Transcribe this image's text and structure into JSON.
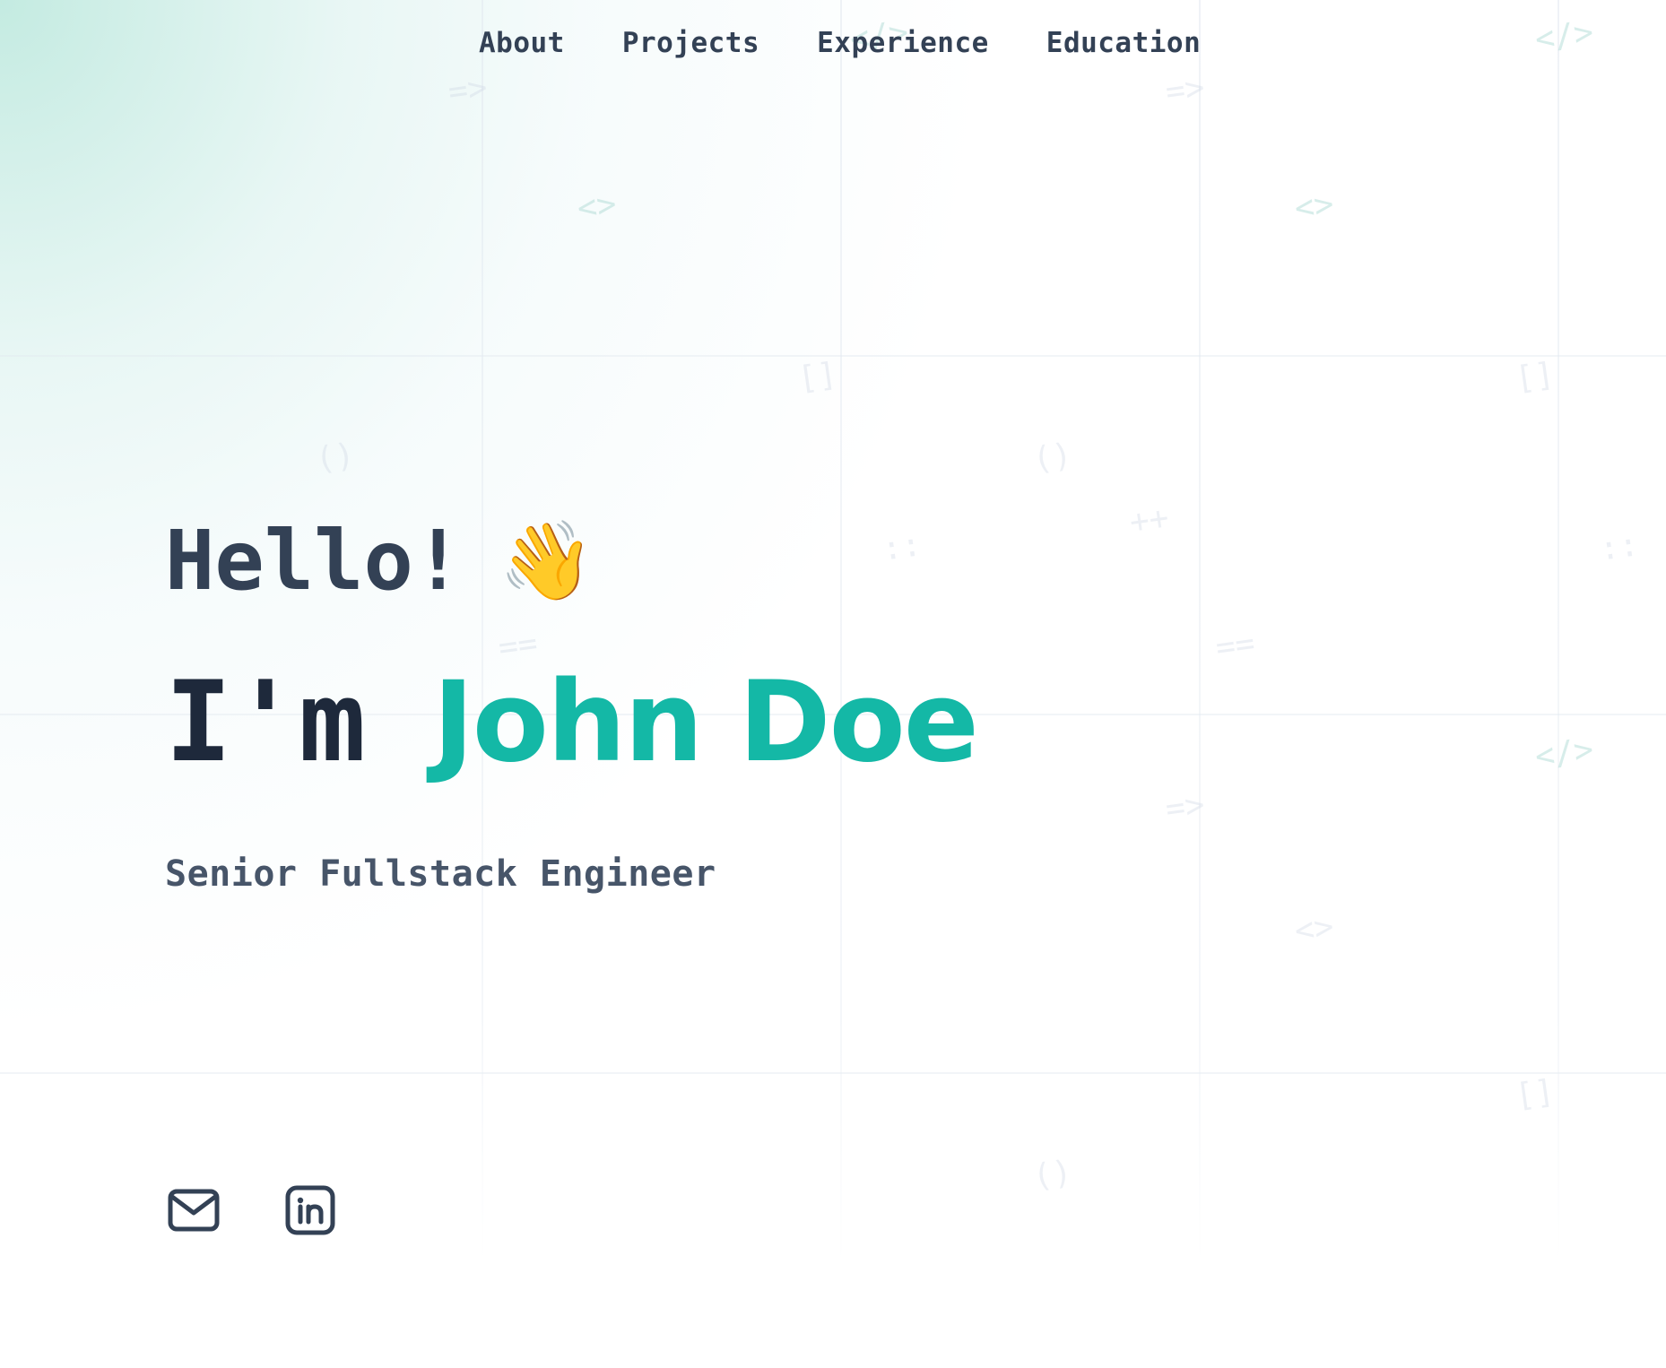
{
  "nav": {
    "items": [
      {
        "label": "About"
      },
      {
        "label": "Projects"
      },
      {
        "label": "Experience"
      },
      {
        "label": "Education"
      }
    ]
  },
  "hero": {
    "greeting": "Hello!",
    "greeting_emoji": "👋",
    "intro_prefix": "I'm",
    "name": "John Doe",
    "role": "Senior Fullstack Engineer"
  },
  "socials": [
    {
      "icon": "mail-icon"
    },
    {
      "icon": "linkedin-icon"
    }
  ],
  "colors": {
    "accent": "#14b8a6",
    "text_dark": "#1e293b",
    "text": "#334155",
    "text_muted": "#475569"
  }
}
